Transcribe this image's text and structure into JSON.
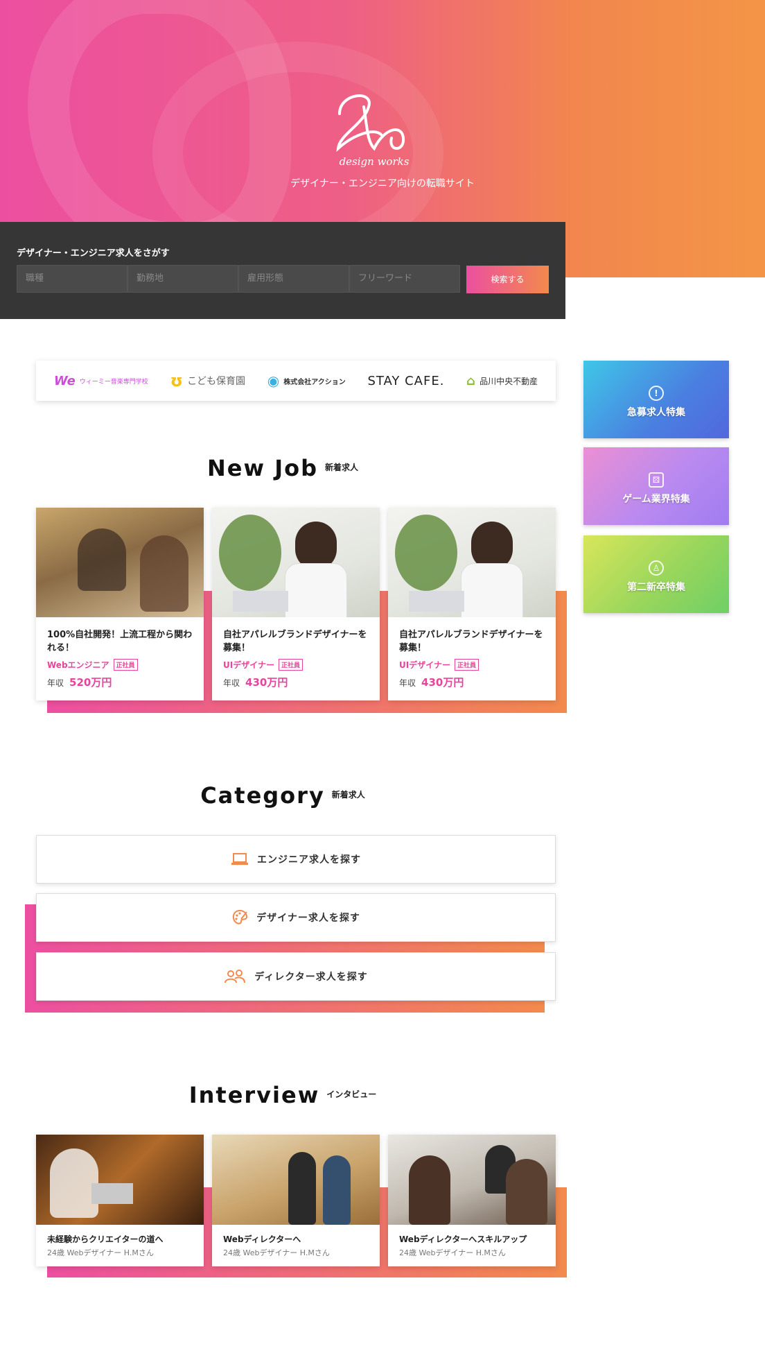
{
  "hero": {
    "logo_text": "design works",
    "tagline": "デザイナー・エンジニア向けの転職サイト"
  },
  "search": {
    "title": "デザイナー・エンジニア求人をさがす",
    "fields": [
      "職種",
      "勤務地",
      "雇用形態",
      "フリーワード"
    ],
    "button": "検索する"
  },
  "partners": [
    {
      "name": "ウィーミー音楽専門学校",
      "mark": "We"
    },
    {
      "name": "こども保育園",
      "mark": "ʊ"
    },
    {
      "name": "株式会社アクション",
      "mark": "◉"
    },
    {
      "name": "STAY CAFE.",
      "mark": ""
    },
    {
      "name": "品川中央不動産",
      "mark": "⌂"
    }
  ],
  "features": [
    {
      "label": "急募求人特集",
      "icon": "!"
    },
    {
      "label": "ゲーム業界特集",
      "icon": "⚄"
    },
    {
      "label": "第二新卒特集",
      "icon": "♙"
    }
  ],
  "new_job": {
    "title_en": "New Job",
    "title_jp": "新着求人",
    "cards": [
      {
        "title": "100%自社開発！上流工程から関われる！",
        "role": "Webエンジニア",
        "tag": "正社員",
        "salary_label": "年収",
        "salary": "520万円"
      },
      {
        "title": "自社アパレルブランドデザイナーを募集！",
        "role": "UIデザイナー",
        "tag": "正社員",
        "salary_label": "年収",
        "salary": "430万円"
      },
      {
        "title": "自社アパレルブランドデザイナーを募集！",
        "role": "UIデザイナー",
        "tag": "正社員",
        "salary_label": "年収",
        "salary": "430万円"
      }
    ]
  },
  "category": {
    "title_en": "Category",
    "title_jp": "新着求人",
    "items": [
      {
        "label": "エンジニア求人を探す",
        "icon": "laptop-icon"
      },
      {
        "label": "デザイナー求人を探す",
        "icon": "palette-icon"
      },
      {
        "label": "ディレクター求人を探す",
        "icon": "people-icon"
      }
    ]
  },
  "interview": {
    "title_en": "Interview",
    "title_jp": "インタビュー",
    "cards": [
      {
        "title": "未経験からクリエイターの道へ",
        "sub": "24歳 Webデザイナー H.Mさん"
      },
      {
        "title": "Webディレクターへ",
        "sub": "24歳 Webデザイナー H.Mさん"
      },
      {
        "title": "Webディレクターへスキルアップ",
        "sub": "24歳 Webデザイナー H.Mさん"
      }
    ]
  },
  "colors": {
    "accent_pink": "#ec4fa0",
    "accent_orange": "#f28a4c",
    "dark": "#363636"
  }
}
